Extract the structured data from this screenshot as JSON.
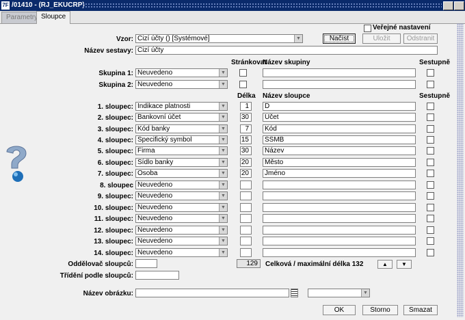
{
  "window": {
    "icon_text": "7F",
    "title": "/01410 - (RJ_EKUCRP)"
  },
  "tabs": [
    {
      "label": "Parametry"
    },
    {
      "label": "Sloupce"
    }
  ],
  "public_settings": {
    "label": "Veřejné nastavení",
    "checked": false
  },
  "vzor": {
    "label": "Vzor:",
    "value": "Cizí účty   ()   [Systémové]"
  },
  "buttons": {
    "load": "Načíst",
    "save": "Uložit",
    "remove": "Odstranit",
    "ok": "OK",
    "cancel": "Storno",
    "delete": "Smazat"
  },
  "set_name": {
    "label": "Název sestavy:",
    "value": "Cizí účty"
  },
  "headers": {
    "page_break": "Stránkovat",
    "group_name": "Název skupiny",
    "descending": "Sestupně",
    "length": "Délka",
    "column_name": "Název sloupce"
  },
  "groups": [
    {
      "label": "Skupina 1:",
      "value": "Neuvedeno",
      "name": ""
    },
    {
      "label": "Skupina 2:",
      "value": "Neuvedeno",
      "name": ""
    }
  ],
  "columns": [
    {
      "label": "1. sloupec:",
      "value": "Indikace platnosti",
      "length": "1",
      "name": "D"
    },
    {
      "label": "2. sloupec:",
      "value": "Bankovní účet",
      "length": "30",
      "name": "Účet"
    },
    {
      "label": "3. sloupec:",
      "value": "Kód banky",
      "length": "7",
      "name": "Kód"
    },
    {
      "label": "4. sloupec:",
      "value": "Specifický symbol",
      "length": "15",
      "name": "SSMB"
    },
    {
      "label": "5. sloupec:",
      "value": "Firma",
      "length": "30",
      "name": "Název"
    },
    {
      "label": "6. sloupec:",
      "value": "Sídlo banky",
      "length": "20",
      "name": "Město"
    },
    {
      "label": "7. sloupec:",
      "value": "Osoba",
      "length": "20",
      "name": "Jméno"
    },
    {
      "label": "8. sloupec",
      "value": "Neuvedeno",
      "length": "",
      "name": ""
    },
    {
      "label": "9. sloupec:",
      "value": "Neuvedeno",
      "length": "",
      "name": ""
    },
    {
      "label": "10. sloupec:",
      "value": "Neuvedeno",
      "length": "",
      "name": ""
    },
    {
      "label": "11. sloupec:",
      "value": "Neuvedeno",
      "length": "",
      "name": ""
    },
    {
      "label": "12. sloupec:",
      "value": "Neuvedeno",
      "length": "",
      "name": ""
    },
    {
      "label": "13. sloupec:",
      "value": "Neuvedeno",
      "length": "",
      "name": ""
    },
    {
      "label": "14. sloupec:",
      "value": "Neuvedeno",
      "length": "",
      "name": ""
    }
  ],
  "separator": {
    "label": "Oddělovač sloupců:",
    "value": ""
  },
  "total": {
    "value": "129",
    "text": "Celková / maximální délka 132"
  },
  "sorting": {
    "label": "Třídění podle sloupců:",
    "value": ""
  },
  "image": {
    "label": "Název obrázku:",
    "value": "",
    "select_value": ""
  },
  "icons": {
    "up": "triangle-up-icon",
    "down": "triangle-down-icon",
    "help": "help-question-icon",
    "list": "list-icon"
  },
  "colors": {
    "titlebar": "#0a2a6b",
    "background": "#f0f0f0"
  }
}
